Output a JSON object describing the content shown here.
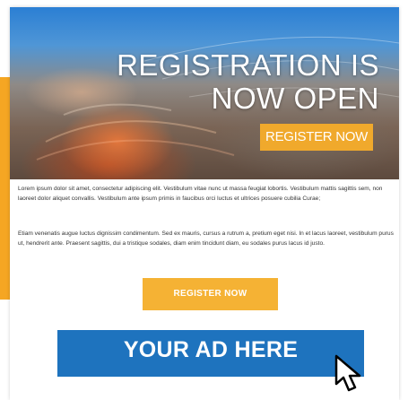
{
  "hero": {
    "title_line1": "REGISTRATION IS",
    "title_line2": "NOW OPEN",
    "button_label": "REGISTER NOW"
  },
  "body": {
    "paragraph1": "Lorem ipsum dolor sit amet, consectetur adipiscing elit. Vestibulum vitae nunc ut massa feugiat lobortis. Vestibulum mattis sagittis sem, non laoreet dolor aliquet convallis. Vestibulum ante ipsum primis in faucibus orci luctus et ultrices posuere cubilia Curae;",
    "paragraph2": "Etiam venenatis augue luctus dignissim condimentum. Sed ex mauris, cursus a rutrum a, pretium eget nisi. In et lacus laoreet, vestibulum purus ut, hendrerit ante. Praesent sagittis, dui a tristique sodales, diam enim tincidunt diam, eu sodales purus lacus id justo."
  },
  "cta": {
    "button_label": "REGISTER NOW"
  },
  "ad": {
    "label": "YOUR AD HERE"
  },
  "icons": {
    "cursor": "pointer-cursor-icon"
  },
  "colors": {
    "accent_orange": "#f5a623",
    "ad_blue": "#1e73be",
    "text": "#333333"
  }
}
